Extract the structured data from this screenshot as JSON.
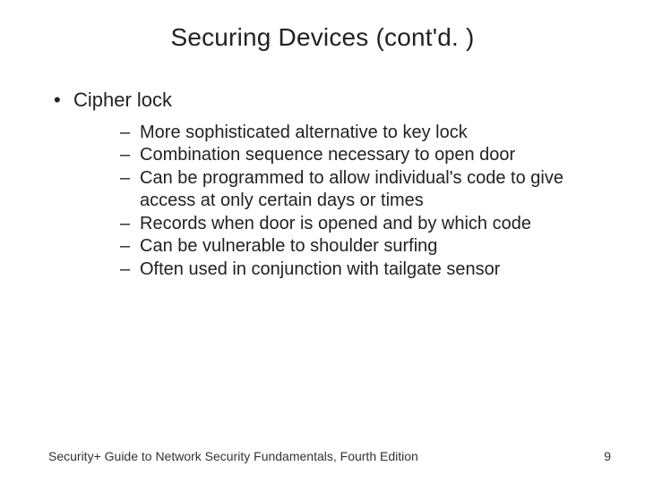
{
  "title": "Securing Devices (cont'd. )",
  "bullet1": {
    "label": "Cipher lock",
    "sub": {
      "a": "More sophisticated alternative to key lock",
      "b": "Combination sequence necessary to open door",
      "c": "Can be programmed to allow individual's code to give access at only certain days or times",
      "d": "Records when door is opened and by which code",
      "e": "Can be vulnerable to shoulder surfing",
      "f": "Often used in conjunction with tailgate sensor"
    }
  },
  "footer_text": "Security+ Guide to Network Security Fundamentals, Fourth Edition",
  "page_number": "9"
}
